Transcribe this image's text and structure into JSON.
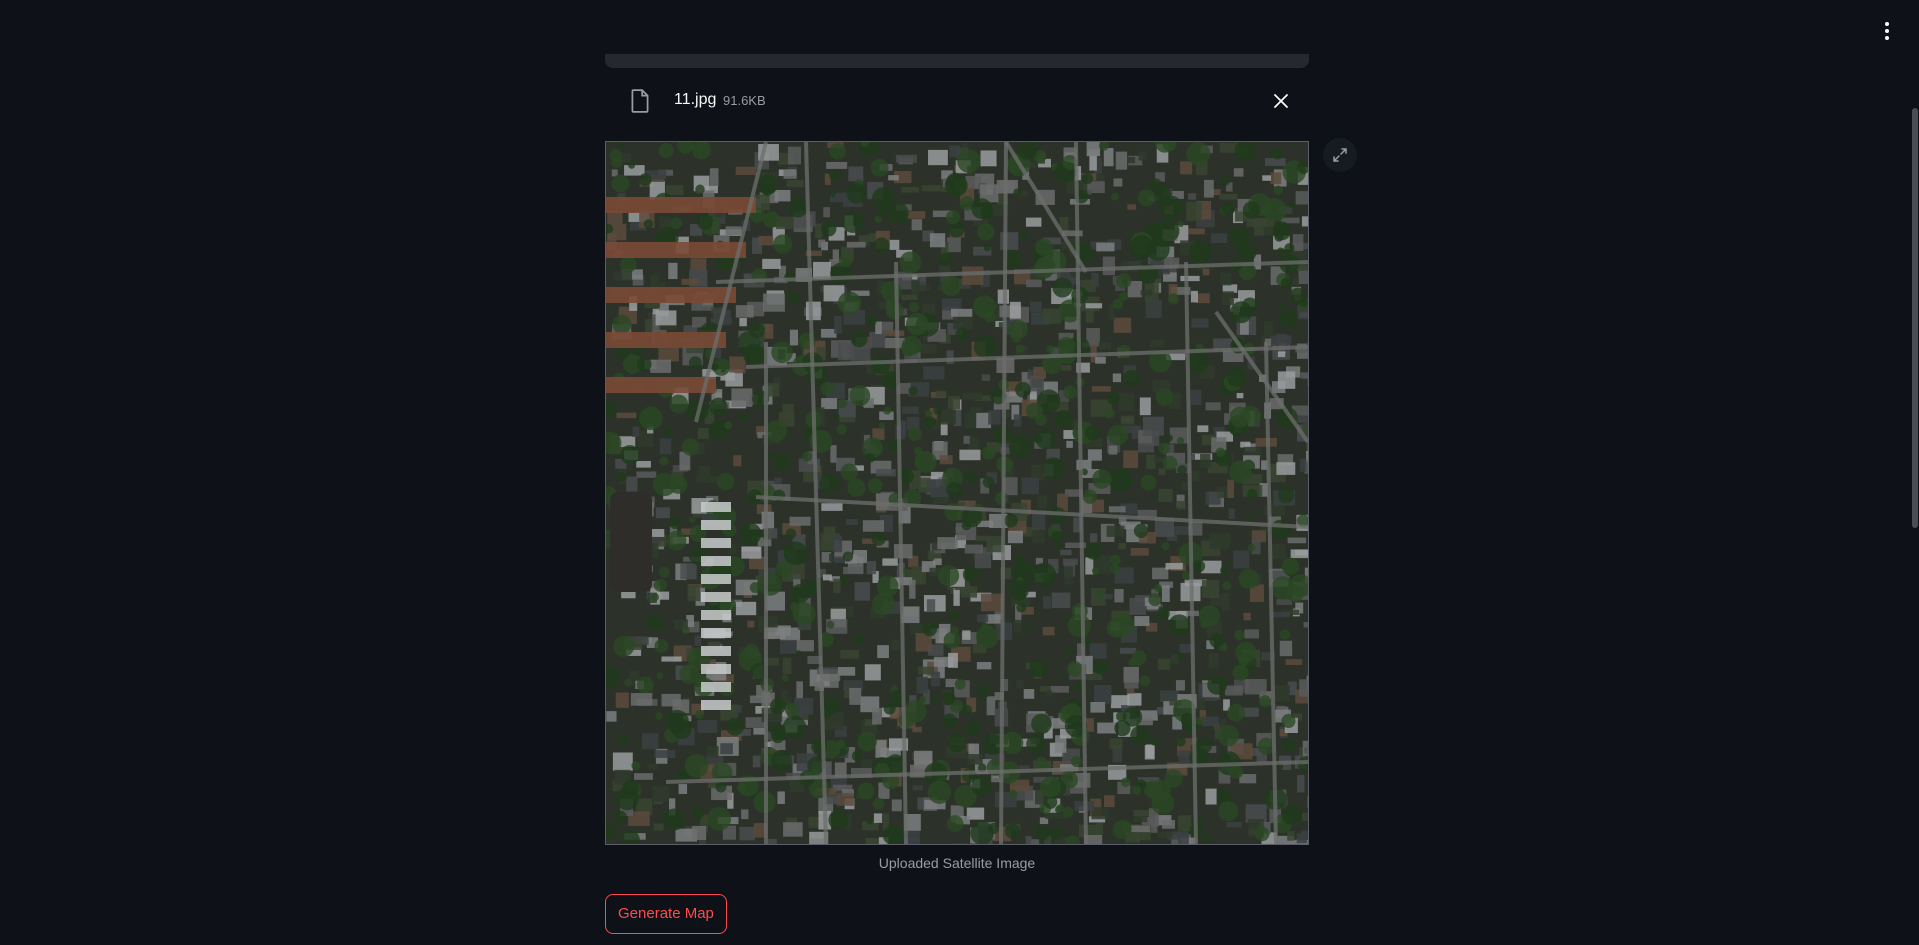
{
  "uploaded_file": {
    "name": "11.jpg",
    "size": "91.6KB",
    "icon": "file-icon",
    "remove_icon": "close-icon"
  },
  "image": {
    "alt": "Uploaded Satellite Image",
    "caption": "Uploaded Satellite Image",
    "fullscreen_icon": "fullscreen-icon"
  },
  "actions": {
    "generate_label": "Generate Map"
  },
  "menu": {
    "icon": "kebab-menu-icon"
  },
  "colors": {
    "background": "#0e1117",
    "text": "#fafafa",
    "muted": "#9a9ca3",
    "accent": "#ff4b4b",
    "surface": "#262730"
  }
}
